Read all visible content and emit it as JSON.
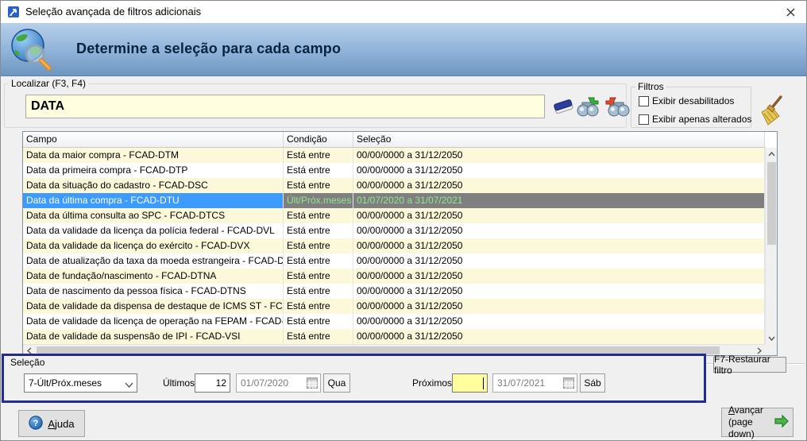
{
  "window": {
    "title": "Seleção avançada de filtros adicionais"
  },
  "banner": {
    "heading": "Determine a seleção para cada campo"
  },
  "localizar": {
    "group_label": "Localizar (F3, F4)",
    "search_value": "DATA"
  },
  "toolbar_icons": [
    "eraser-icon",
    "binoculars-next-icon",
    "binoculars-previous-icon",
    "broom-icon"
  ],
  "filtros": {
    "group_label": "Filtros",
    "checkbox_disabled_label": "Exibir desabilitados",
    "checkbox_changed_label": "Exibir apenas alterados",
    "checkbox_disabled_checked": false,
    "checkbox_changed_checked": false
  },
  "table": {
    "columns": [
      "Campo",
      "Condição",
      "Seleção"
    ],
    "rows": [
      {
        "campo": "Data da maior compra - FCAD-DTM",
        "condicao": "Está entre",
        "selecao": "00/00/0000 a 31/12/2050",
        "selected": false
      },
      {
        "campo": "Data da primeira compra - FCAD-DTP",
        "condicao": "Está entre",
        "selecao": "00/00/0000 a 31/12/2050",
        "selected": false
      },
      {
        "campo": "Data da situação do cadastro - FCAD-DSC",
        "condicao": "Está entre",
        "selecao": "00/00/0000 a 31/12/2050",
        "selected": false
      },
      {
        "campo": "Data da última compra - FCAD-DTU",
        "condicao": "Últ/Próx.meses",
        "selecao": "01/07/2020 a 31/07/2021",
        "selected": true
      },
      {
        "campo": "Data da última consulta ao SPC - FCAD-DTCS",
        "condicao": "Está entre",
        "selecao": "00/00/0000 a 31/12/2050",
        "selected": false
      },
      {
        "campo": "Data da validade da licença da polícia federal - FCAD-DVL",
        "condicao": "Está entre",
        "selecao": "00/00/0000 a 31/12/2050",
        "selected": false
      },
      {
        "campo": "Data da validade da licença do exército - FCAD-DVX",
        "condicao": "Está entre",
        "selecao": "00/00/0000 a 31/12/2050",
        "selected": false
      },
      {
        "campo": "Data de atualização da taxa da moeda estrangeira - FCAD-DAME",
        "condicao": "Está entre",
        "selecao": "00/00/0000 a 31/12/2050",
        "selected": false
      },
      {
        "campo": "Data de fundação/nascimento - FCAD-DTNA",
        "condicao": "Está entre",
        "selecao": "00/00/0000 a 31/12/2050",
        "selected": false
      },
      {
        "campo": "Data de nascimento da pessoa física - FCAD-DTNS",
        "condicao": "Está entre",
        "selecao": "00/00/0000 a 31/12/2050",
        "selected": false
      },
      {
        "campo": "Data de validade da dispensa de destaque de ICMS ST - FCAD-VDS",
        "condicao": "Está entre",
        "selecao": "00/00/0000 a 31/12/2050",
        "selected": false
      },
      {
        "campo": "Data de validade da licença de operação na FEPAM - FCAD-DVLO",
        "condicao": "Está entre",
        "selecao": "00/00/0000 a 31/12/2050",
        "selected": false
      },
      {
        "campo": "Data de validade da suspensão de IPI - FCAD-VSI",
        "condicao": "Está entre",
        "selecao": "00/00/0000 a 31/12/2050",
        "selected": false
      }
    ]
  },
  "selecao": {
    "group_label": "Seleção",
    "dropdown_value": "7-Últ/Próx.meses",
    "ultimos_label": "Últimos",
    "ultimos_value": "12",
    "start_date": "01/07/2020",
    "start_weekday": "Qua",
    "proximos_label": "Próximos",
    "proximos_value": "",
    "end_date": "31/07/2021",
    "end_weekday": "Sáb"
  },
  "buttons": {
    "restore_filter": "F7-Restaurar filtro",
    "help": "Ajuda",
    "advance_line1": "Avançar",
    "advance_line2": "(page down)"
  },
  "colors": {
    "accent-selection": "#3d9bff",
    "row-yellow": "#fbf9da",
    "highlight-cell-bg": "#7f7f7f",
    "highlight-cell-text": "#90e890",
    "panel-border": "#232d8e",
    "search-input-bg": "#ffffdf",
    "proximos-input-bg": "#ffff9e",
    "banner-top": "#b6cfeb",
    "banner-bottom": "#6e96c0"
  }
}
